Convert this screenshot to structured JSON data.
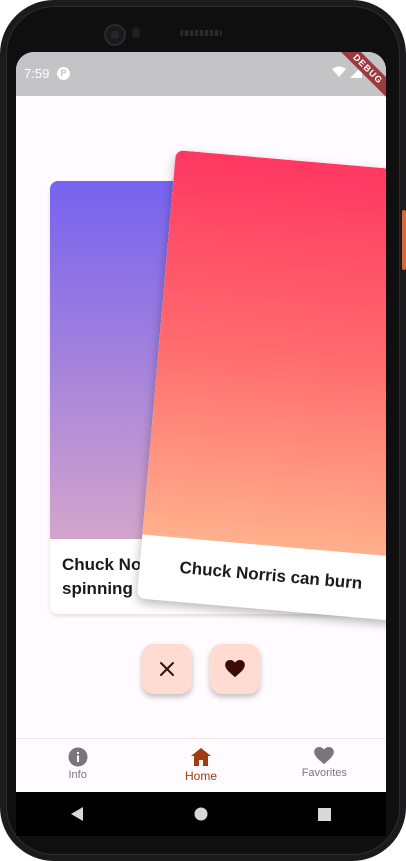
{
  "status_bar": {
    "time": "7:59",
    "app_icon_letter": "P",
    "debug_label": "DEBUG"
  },
  "cards": {
    "back_caption": "Chuck Norris\nspinning rims",
    "front_caption": "Chuck Norris can burn"
  },
  "actions": {
    "dislike_icon": "close-icon",
    "like_icon": "heart-icon"
  },
  "bottom_nav": {
    "items": [
      {
        "label": "Info",
        "icon": "info-icon"
      },
      {
        "label": "Home",
        "icon": "home-icon"
      },
      {
        "label": "Favorites",
        "icon": "heart-icon"
      }
    ],
    "active_index": 1
  },
  "colors": {
    "accent": "#a13c12",
    "button_bg": "#ffdbd1",
    "inactive": "#7c7577"
  }
}
